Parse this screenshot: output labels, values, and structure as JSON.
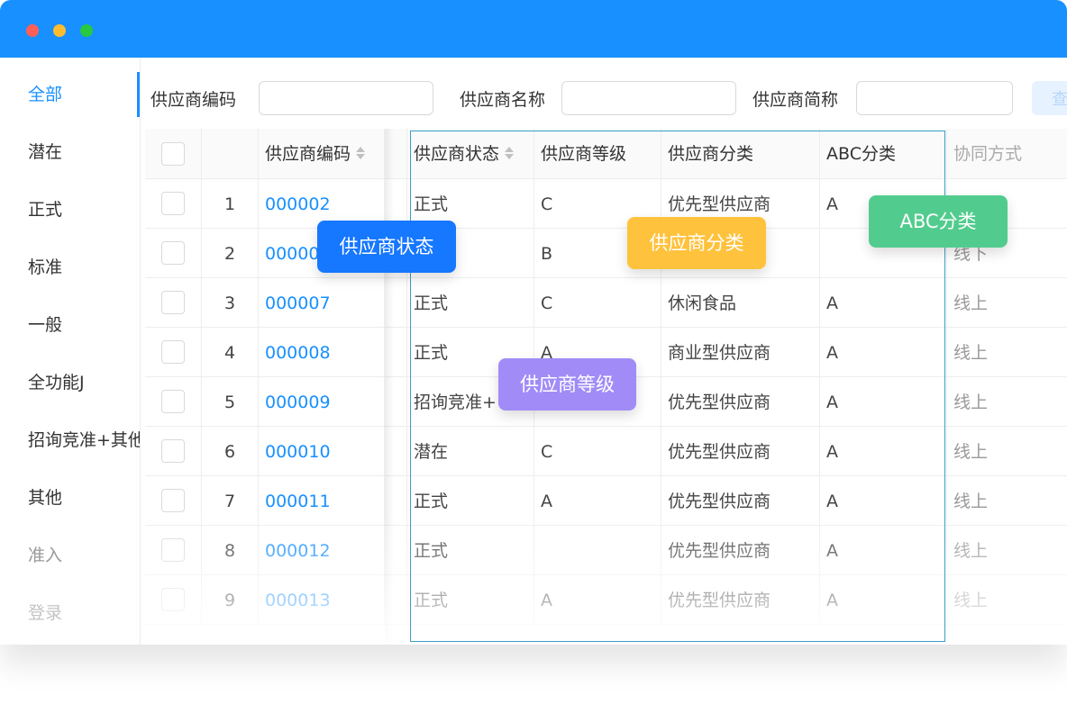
{
  "sidebar": {
    "items": [
      {
        "label": "全部",
        "active": true
      },
      {
        "label": "潜在"
      },
      {
        "label": "正式"
      },
      {
        "label": "标准"
      },
      {
        "label": "一般"
      },
      {
        "label": "全功能J"
      },
      {
        "label": "招询竞准+其他"
      },
      {
        "label": "其他"
      },
      {
        "label": "准入"
      },
      {
        "label": "登录"
      }
    ]
  },
  "search": {
    "code_label": "供应商编码",
    "name_label": "供应商名称",
    "short_label": "供应商简称",
    "query_label": "查"
  },
  "table": {
    "headers": {
      "code": "供应商编码",
      "status": "供应商状态",
      "level": "供应商等级",
      "category": "供应商分类",
      "abc": "ABC分类",
      "coop": "协同方式"
    },
    "rows": [
      {
        "index": "1",
        "code": "000002",
        "status": "正式",
        "level": "C",
        "category": "优先型供应商",
        "abc": "A",
        "coop": ""
      },
      {
        "index": "2",
        "code": "000006",
        "status": "",
        "level": "B",
        "category": "",
        "abc": "",
        "coop": "线下"
      },
      {
        "index": "3",
        "code": "000007",
        "status": "正式",
        "level": "C",
        "category": "休闲食品",
        "abc": "A",
        "coop": "线上"
      },
      {
        "index": "4",
        "code": "000008",
        "status": "正式",
        "level": "A",
        "category": "商业型供应商",
        "abc": "A",
        "coop": "线上"
      },
      {
        "index": "5",
        "code": "000009",
        "status": "招询竞准+",
        "level": "",
        "category": "优先型供应商",
        "abc": "A",
        "coop": "线上"
      },
      {
        "index": "6",
        "code": "000010",
        "status": "潜在",
        "level": "C",
        "category": "优先型供应商",
        "abc": "A",
        "coop": "线上"
      },
      {
        "index": "7",
        "code": "000011",
        "status": "正式",
        "level": "A",
        "category": "优先型供应商",
        "abc": "A",
        "coop": "线上"
      },
      {
        "index": "8",
        "code": "000012",
        "status": "正式",
        "level": "",
        "category": "优先型供应商",
        "abc": "A",
        "coop": "线上"
      },
      {
        "index": "9",
        "code": "000013",
        "status": "正式",
        "level": "A",
        "category": "优先型供应商",
        "abc": "A",
        "coop": "线上"
      }
    ]
  },
  "tags": {
    "status": "供应商状态",
    "category": "供应商分类",
    "abc": "ABC分类",
    "level": "供应商等级"
  },
  "colors": {
    "primary": "#1890ff",
    "tag_blue": "#1677ff",
    "tag_yellow": "#ffc23d",
    "tag_green": "#52cc8e",
    "tag_purple": "#a18cf7"
  }
}
